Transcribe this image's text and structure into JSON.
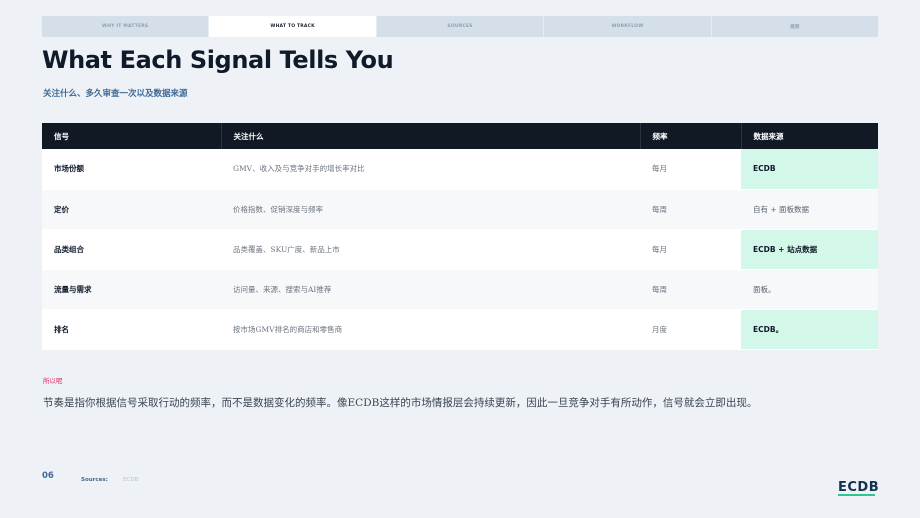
{
  "tabs": [
    "WHY IT MATTERS",
    "WHAT TO TRACK",
    "SOURCES",
    "WORKFLOW",
    "规则"
  ],
  "active_tab": 1,
  "title": "What Each Signal Tells You",
  "subtitle": "关注什么、多久审查一次以及数据来源",
  "table": {
    "headers": [
      "信号",
      "关注什么",
      "频率",
      "数据来源"
    ],
    "rows": [
      {
        "signal": "市场份额",
        "what": "GMV、收入及与竞争对手的增长率对比",
        "freq": "每月",
        "source": "ECDB",
        "highlight": true
      },
      {
        "signal": "定价",
        "what": "价格指数、促销深度与频率",
        "freq": "每周",
        "source": "自有 + 面板数据",
        "highlight": false
      },
      {
        "signal": "品类组合",
        "what": "品类覆盖、SKU广度、新品上市",
        "freq": "每月",
        "source": "ECDB + 站点数据",
        "highlight": true
      },
      {
        "signal": "流量与需求",
        "what": "访问量、来源、搜索与AI推荐",
        "freq": "每周",
        "source": "面板。",
        "highlight": false
      },
      {
        "signal": "排名",
        "what": "按市场GMV排名的商店和零售商",
        "freq": "月度",
        "source": "ECDB。",
        "highlight": true
      }
    ]
  },
  "note": {
    "label": "所以呢",
    "text": "节奏是指你根据信号采取行动的频率，而不是数据变化的频率。像ECDB这样的市场情报层会持续更新，因此一旦竞争对手有所动作，信号就会立即出现。"
  },
  "footer": {
    "page_number": "06",
    "sources_label": "Sources:",
    "sources_value": "ECDB",
    "logo": "ECDB"
  },
  "colors": {
    "header_bg": "#111a24",
    "highlight": "#d3f7e8",
    "accent_blue": "#3f6a95",
    "accent_pink": "#e0245e",
    "logo_underline": "#2ec58f"
  }
}
